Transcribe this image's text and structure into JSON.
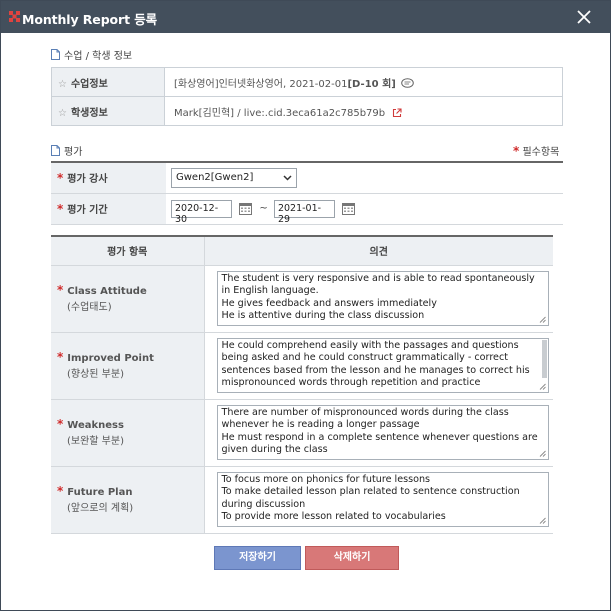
{
  "window": {
    "title": "Monthly Report 등록",
    "colors": {
      "titlebar": "#434f5c",
      "required_star": "#d02b2b",
      "save_button": "#7b95cf",
      "delete_button": "#d87878"
    }
  },
  "class_section": {
    "title": "수업 / 학생 정보",
    "rows": [
      {
        "label": "수업정보",
        "value_prefix": "[화상영어]인터넷화상영어, 2021-02-01",
        "dday": "[D-10 회]",
        "icon": "speech-bubble-icon"
      },
      {
        "label": "학생정보",
        "value": "Mark[김민혁] / live:.cid.3eca61a2c785b79b",
        "icon": "external-link-icon"
      }
    ]
  },
  "eval_section": {
    "title": "평가",
    "required_note": "필수항목",
    "teacher_label": "평가 강사",
    "teacher_value": "Gwen2[Gwen2]",
    "period_label": "평가 기간",
    "period_start": "2020-12-30",
    "period_separator": "~",
    "period_end": "2021-01-29"
  },
  "review_table": {
    "headers": [
      "평가 항목",
      "의견"
    ],
    "rows": [
      {
        "label_en": "Class Attitude",
        "label_ko": "(수업태도)",
        "lines": [
          "The student is very responsive and is able to read spontaneously in English language.",
          "He gives feedback and answers immediately",
          "He is attentive during the class discussion"
        ]
      },
      {
        "label_en": "Improved Point",
        "label_ko": "(향상된 부분)",
        "lines": [
          "He could comprehend easily with the passages and questions being asked and he could construct grammatically - correct sentences based from the lesson and he manages to correct his mispronounced words through repetition and practice"
        ]
      },
      {
        "label_en": "Weakness",
        "label_ko": "(보완할 부분)",
        "lines": [
          "There are number of mispronounced words during the class whenever he is reading a longer passage",
          "He must respond in a complete sentence whenever questions are given during the class"
        ]
      },
      {
        "label_en": "Future Plan",
        "label_ko": "(앞으로의 계획)",
        "lines": [
          "To focus more on phonics for future lessons",
          "To make detailed lesson plan related to sentence construction during discussion",
          "To provide more lesson related to vocabularies"
        ]
      }
    ]
  },
  "buttons": {
    "save": "저장하기",
    "delete": "삭제하기"
  }
}
